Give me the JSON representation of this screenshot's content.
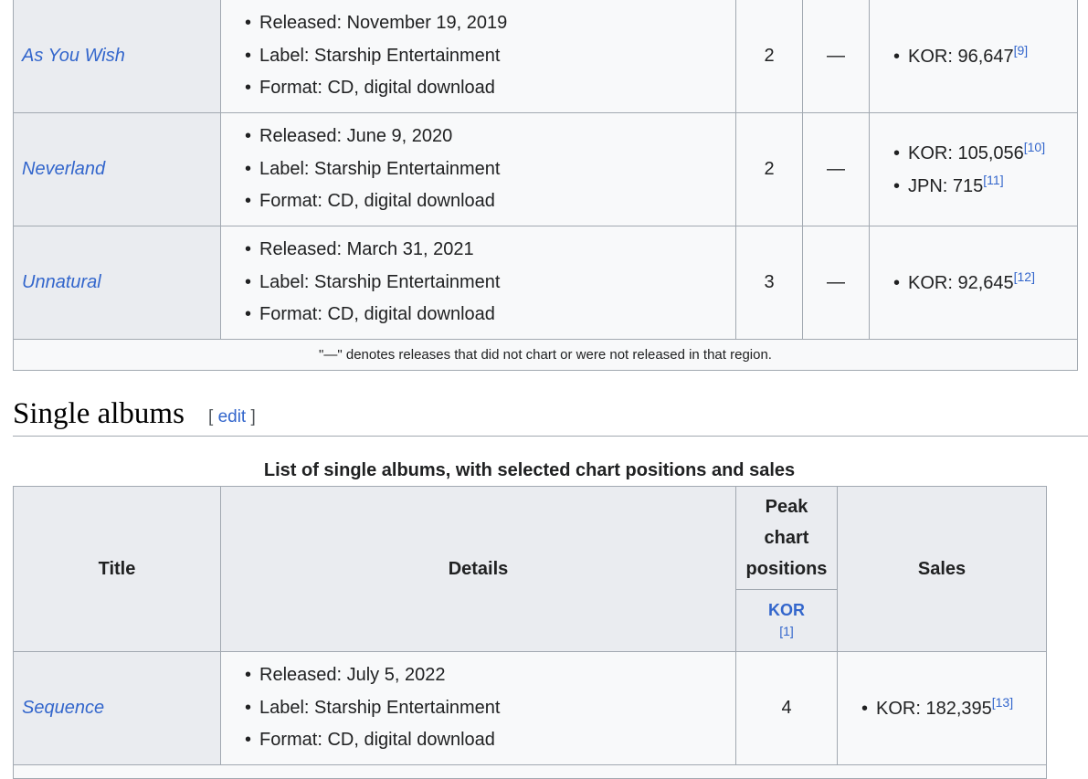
{
  "studio_albums": {
    "rows": [
      {
        "title": "As You Wish",
        "released": "Released: November 19, 2019",
        "label": "Label: Starship Entertainment",
        "format": "Format: CD, digital download",
        "peak_kor": "2",
        "peak_other": "—",
        "sales": [
          {
            "text": "KOR: 96,647",
            "ref": "[9]"
          }
        ]
      },
      {
        "title": "Neverland",
        "released": "Released: June 9, 2020",
        "label": "Label: Starship Entertainment",
        "format": "Format: CD, digital download",
        "peak_kor": "2",
        "peak_other": "—",
        "sales": [
          {
            "text": "KOR: 105,056",
            "ref": "[10]"
          },
          {
            "text": "JPN: 715",
            "ref": "[11]"
          }
        ]
      },
      {
        "title": "Unnatural",
        "released": "Released: March 31, 2021",
        "label": "Label: Starship Entertainment",
        "format": "Format: CD, digital download",
        "peak_kor": "3",
        "peak_other": "—",
        "sales": [
          {
            "text": "KOR: 92,645",
            "ref": "[12]"
          }
        ]
      }
    ],
    "footnote": "\"—\" denotes releases that did not chart or were not released in that region."
  },
  "single_albums_section": {
    "heading": "Single albums",
    "edit_open": "[",
    "edit_label": "edit",
    "edit_close": "]"
  },
  "single_albums_table": {
    "caption": "List of single albums, with selected chart positions and sales",
    "headers": {
      "title": "Title",
      "details": "Details",
      "peak_line1": "Peak",
      "peak_line2": "chart",
      "peak_line3": "positions",
      "kor": "KOR",
      "kor_ref": "[1]",
      "sales": "Sales"
    },
    "rows": [
      {
        "title": "Sequence",
        "released": "Released: July 5, 2022",
        "label": "Label: Starship Entertainment",
        "format": "Format: CD, digital download",
        "peak_kor": "4",
        "sales": [
          {
            "text": "KOR: 182,395",
            "ref": "[13]"
          }
        ]
      }
    ]
  }
}
